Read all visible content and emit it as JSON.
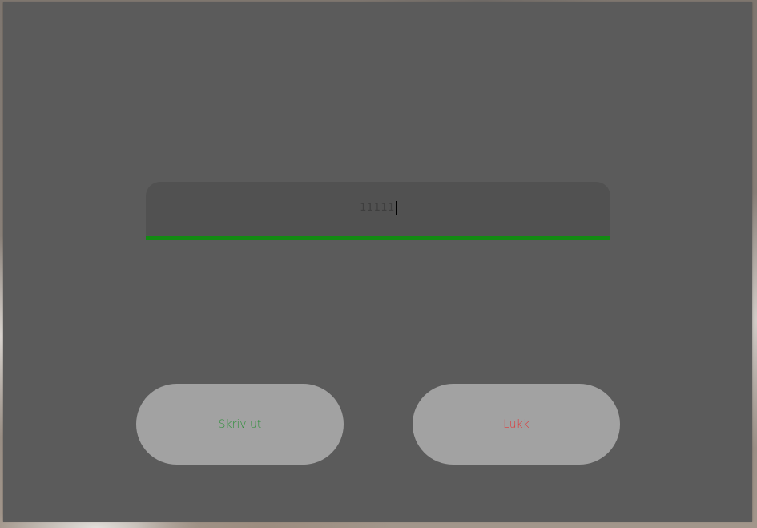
{
  "input": {
    "value": "11111"
  },
  "buttons": {
    "print_label": "Skriv ut",
    "close_label": "Lukk"
  },
  "colors": {
    "dialog_bg": "#5b5b5b",
    "input_bg": "#515151",
    "input_underline": "#138a13",
    "button_bg": "#a2a2a2",
    "print_text": "#2f8f3a",
    "close_text": "#e0393a"
  }
}
